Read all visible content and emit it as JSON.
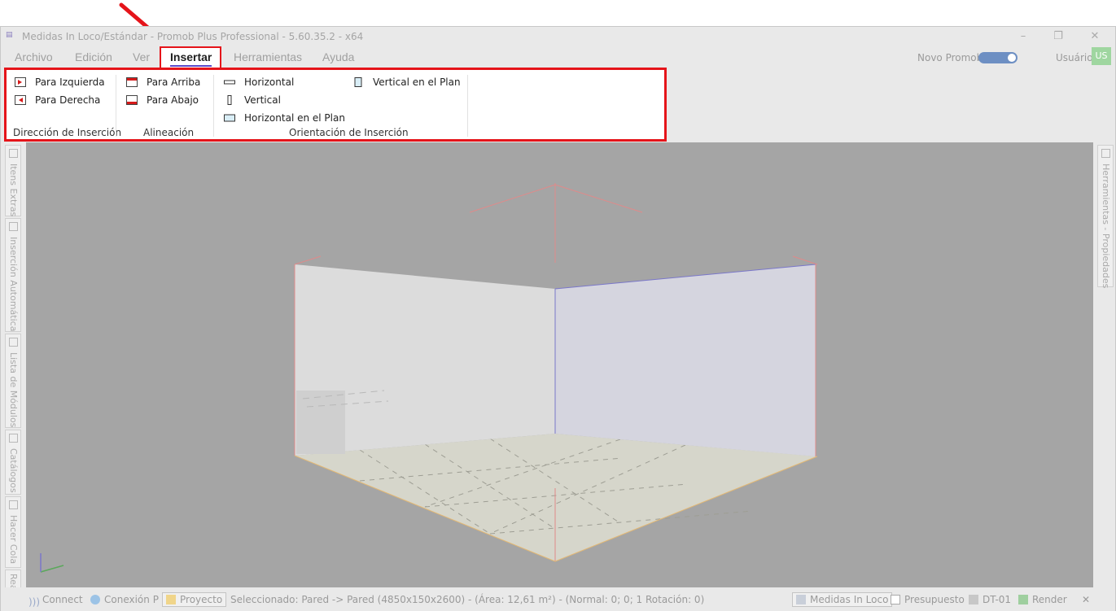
{
  "window": {
    "title": "Medidas In Loco/Estándar - Promob Plus Professional - 5.60.35.2 - x64",
    "icon": "promob-app-icon",
    "controls": [
      "minimize-icon",
      "restore-icon",
      "close-icon"
    ]
  },
  "menu": {
    "tabs": [
      "Archivo",
      "Edición",
      "Ver",
      "Insertar",
      "Herramientas",
      "Ayuda"
    ],
    "active": "Insertar"
  },
  "topright": {
    "novo_label": "Novo Promob",
    "toggle_on": true,
    "user_label": "Usuário",
    "avatar": "US"
  },
  "ribbon": {
    "groups": [
      {
        "label": "Dirección de Inserción",
        "items": [
          "Para Izquierda",
          "Para Derecha"
        ]
      },
      {
        "label": "Alineación",
        "items": [
          "Para Arriba",
          "Para Abajo"
        ]
      },
      {
        "label": "Orientación de Inserción",
        "items": [
          "Horizontal",
          "Vertical",
          "Horizontal en el Plan",
          "Vertical en el Plan"
        ]
      }
    ]
  },
  "left_panel": {
    "tabs": [
      "Itens Extras",
      "Inserción Automática",
      "Lista de Módulos",
      "Catálogos",
      "Hacer Cola",
      "Real Scene"
    ]
  },
  "right_panel": {
    "tabs": [
      "Herramientas - Propiedades"
    ]
  },
  "statusbar": {
    "connect": "Connect",
    "conexion": "Conexión P",
    "proyecto": "Proyecto",
    "selection": "Seleccionado: Pared -> Pared (4850x150x2600) - (Área: 12,61 m²) - (Normal: 0; 0; 1 Rotación: 0)",
    "medidas": "Medidas In Loco",
    "presupuesto": "Presupuesto",
    "dt": "DT-01",
    "render": "Render"
  },
  "colors": {
    "highlight": "#e5141a",
    "accent": "#5a49c9",
    "toggle": "#6d8fc3",
    "avatar": "#9fd6a0",
    "viewport": "#a5a5a5"
  }
}
